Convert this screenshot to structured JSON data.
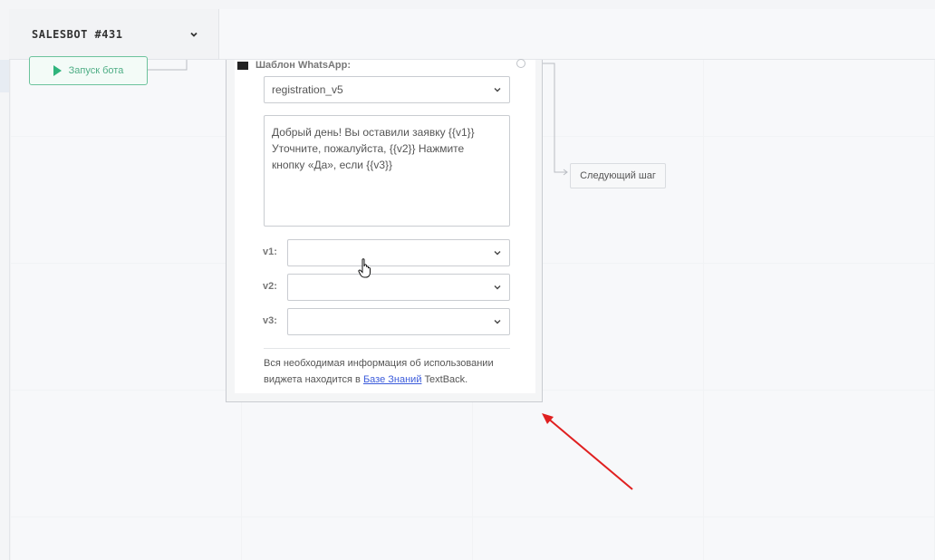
{
  "bot_selector": {
    "name": "SALESBOT #431",
    "icon": "chevron-down-icon"
  },
  "start_node": {
    "label": "Запуск бота",
    "icon": "play-icon",
    "color": "#2fb47c"
  },
  "widget": {
    "template_label": "Шаблон WhatsApp:",
    "template_value": "registration_v5",
    "message_text": "Добрый день! Вы оставили заявку {{v1}}\nУточните, пожалуйста, {{v2}} Нажмите\nкнопку «Да», если {{v3}}",
    "variables": [
      {
        "label": "v1:",
        "value": ""
      },
      {
        "label": "v2:",
        "value": ""
      },
      {
        "label": "v3:",
        "value": ""
      }
    ],
    "info_prefix": "Вся необходимая информация об использовании виджета находится в ",
    "info_link": "Базе Знаний",
    "info_suffix": " TextBack."
  },
  "next_step": {
    "label": "Следующий шаг"
  },
  "colors": {
    "accent_green": "#2fb47c",
    "link": "#3b5bdb",
    "arrow": "#e02020"
  }
}
